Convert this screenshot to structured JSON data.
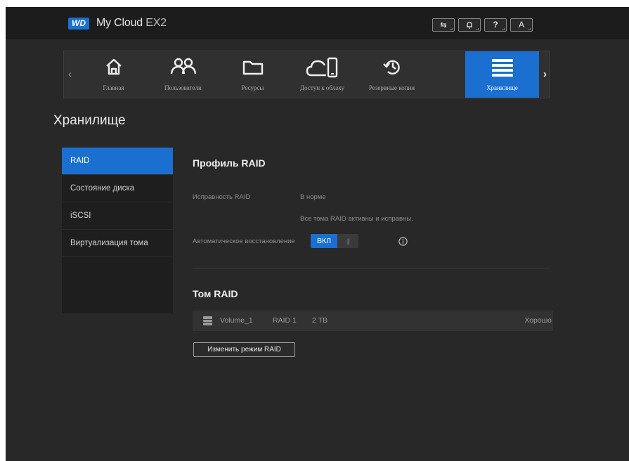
{
  "header": {
    "logo_text": "WD",
    "app_name": "My Cloud",
    "model": "EX2",
    "buttons": [
      {
        "icon": "usb-icon",
        "glyph": "⇆"
      },
      {
        "icon": "bell-icon",
        "glyph": "🔔"
      },
      {
        "icon": "help-icon",
        "glyph": "?"
      },
      {
        "icon": "user-icon",
        "glyph": "A"
      }
    ]
  },
  "nav": {
    "items": [
      {
        "label": "Главная",
        "icon": "home-icon"
      },
      {
        "label": "Пользователи",
        "icon": "users-icon"
      },
      {
        "label": "Ресурсы",
        "icon": "folder-icon"
      },
      {
        "label": "Доступ к облаку",
        "icon": "cloud-device-icon"
      },
      {
        "label": "Резервные копии",
        "icon": "backup-icon"
      },
      {
        "label": "Хранилище",
        "icon": "storage-icon",
        "active": true
      }
    ]
  },
  "page_title": "Хранилище",
  "sidebar": {
    "items": [
      {
        "label": "RAID",
        "active": true
      },
      {
        "label": "Состояние диска"
      },
      {
        "label": "iSCSI"
      },
      {
        "label": "Виртуализация тома"
      }
    ]
  },
  "raid_profile": {
    "title": "Профиль RAID",
    "health_label": "Исправность RAID",
    "health_value": "В норме",
    "health_detail": "Все тома RAID активны и исправны.",
    "auto_rebuild_label": "Автоматическое восстановление",
    "toggle_on": "ВКЛ",
    "toggle_grip": "|||"
  },
  "raid_volume": {
    "title": "Том RAID",
    "row": {
      "name": "Volume_1",
      "level": "RAID 1",
      "size": "2 TB",
      "status": "Хорошо"
    },
    "change_button": "Изменить режим RAID"
  },
  "colors": {
    "accent": "#1a6fd0",
    "background": "#282828",
    "header": "#1c1c1c"
  }
}
